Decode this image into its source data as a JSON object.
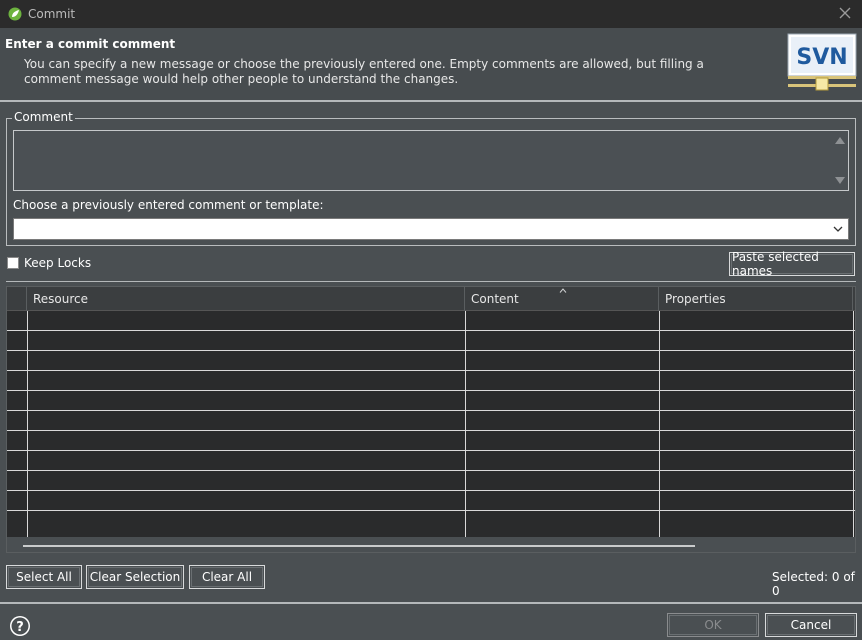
{
  "window": {
    "title": "Commit",
    "app_icon": "spring-leaf-icon",
    "close_icon": "close-icon"
  },
  "header": {
    "title": "Enter a commit comment",
    "description": "You can specify a new message or choose the previously entered one. Empty comments are allowed, but filling a comment message would help other people to understand the changes.",
    "logo_text": "SVN"
  },
  "comment_group": {
    "legend": "Comment",
    "comment_value": "",
    "choose_label": "Choose a previously entered comment or template:",
    "combo_value": ""
  },
  "options": {
    "keep_locks_label": "Keep Locks",
    "keep_locks_checked": false,
    "paste_button": "Paste selected names"
  },
  "table": {
    "columns": [
      "Resource",
      "Content",
      "Properties"
    ],
    "rows": []
  },
  "selection": {
    "select_all": "Select All",
    "clear_selection": "Clear Selection",
    "clear_all": "Clear All",
    "selected_text": "Selected: 0 of 0"
  },
  "footer": {
    "ok": "OK",
    "cancel": "Cancel",
    "help_icon": "help-icon"
  },
  "colors": {
    "background": "#4a4f52",
    "titlebar": "#2b2b2b",
    "table_bg": "#2a2b2c",
    "svn_blue": "#1f5a9e"
  }
}
